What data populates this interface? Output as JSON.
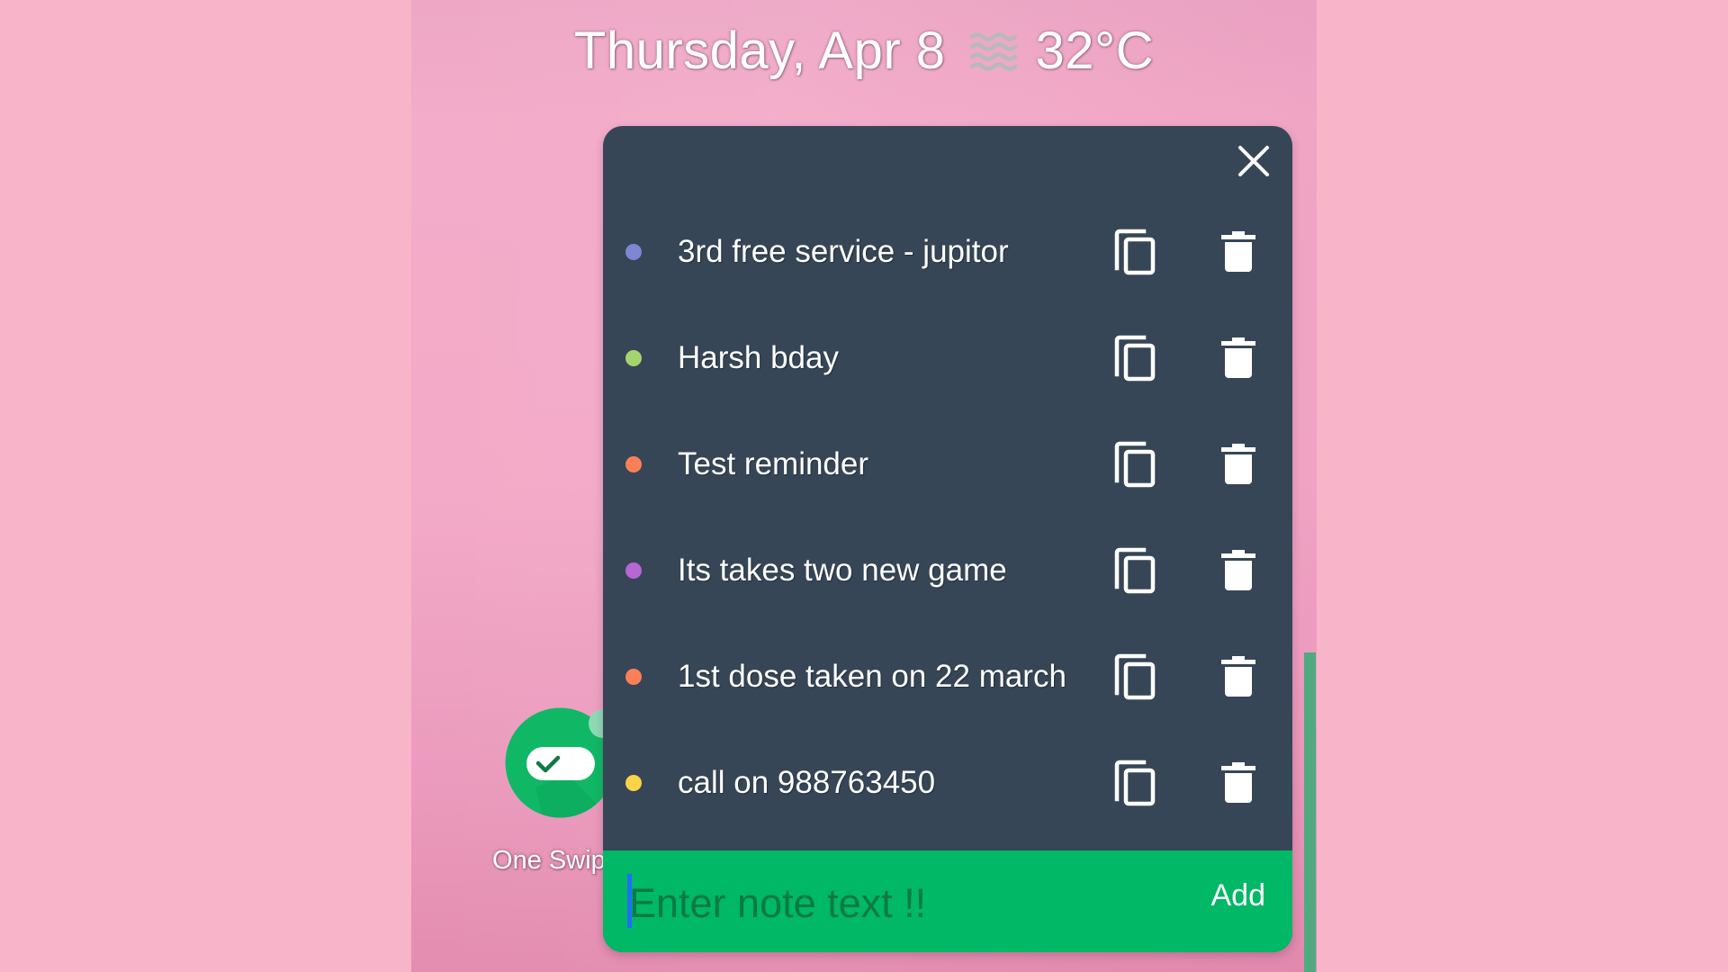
{
  "header": {
    "date": "Thursday, Apr 8",
    "weather_icon": "haze-icon",
    "temperature": "32°C"
  },
  "notes_panel": {
    "close_icon": "close-icon",
    "notes": [
      {
        "text": "3rd free service - jupitor",
        "color": "#7f86d3"
      },
      {
        "text": "Harsh bday",
        "color": "#a5d46f"
      },
      {
        "text": "Test reminder",
        "color": "#fb8058"
      },
      {
        "text": "Its takes two new game",
        "color": "#b866d4"
      },
      {
        "text": "1st dose taken on 22 march",
        "color": "#fb8058"
      },
      {
        "text": "call on 988763450",
        "color": "#fbd346"
      }
    ],
    "row_actions": {
      "copy_icon": "copy-icon",
      "delete_icon": "trash-icon"
    },
    "input": {
      "value": "",
      "placeholder": "Enter note text !!"
    },
    "add_label": "Add"
  },
  "app_shortcut": {
    "label": "One Swip...",
    "icon": "toggle-check-icon"
  },
  "colors": {
    "panel_bg": "#364657",
    "footer_bg": "#00b865",
    "wallpaper": "#f3aac8",
    "outer_bg": "#f8b4c9",
    "scrollbar": "#4faa81"
  }
}
